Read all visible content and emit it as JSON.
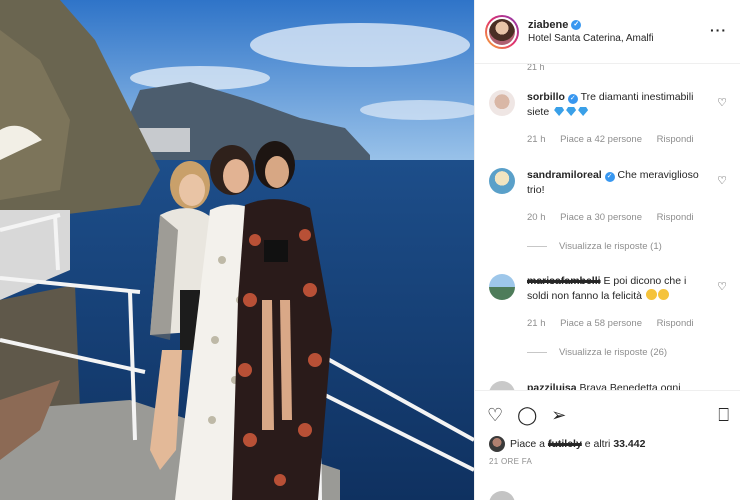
{
  "header": {
    "username": "ziabene",
    "location": "Hotel Santa Caterina, Amalfi",
    "more_icon": "more-horizontal-icon"
  },
  "comments": {
    "truncated_time": "21 h",
    "items": [
      {
        "user": "sorbillo",
        "verified": true,
        "text": "Tre diamanti inestimabili siete",
        "emoji": "gem-icon x3",
        "time": "21 h",
        "likes": "Piace a 42 persone",
        "reply": "Rispondi"
      },
      {
        "user": "sandramiloreal",
        "verified": true,
        "text": "Che meraviglioso trio!",
        "time": "20 h",
        "likes": "Piace a 30 persone",
        "reply": "Rispondi",
        "view_replies": "Visualizza le risposte (1)"
      },
      {
        "user": "marisafambelli",
        "verified": false,
        "text": "E poi dicono che i soldi non fanno la felicità",
        "emoji": "grinning-face x2",
        "time": "21 h",
        "likes": "Piace a 58 persone",
        "reply": "Rispondi",
        "view_replies": "Visualizza le risposte (26)"
      },
      {
        "user": "pazziluisa",
        "verified": false,
        "text": "Brava Benedetta ogni"
      }
    ]
  },
  "actions": {
    "like_icon": "heart-icon",
    "comment_icon": "comment-icon",
    "share_icon": "send-icon",
    "save_icon": "bookmark-icon",
    "likes_prefix": "Piace a",
    "likes_user": "futilely",
    "likes_suffix": "e altri",
    "likes_count": "33.442",
    "time": "21 ORE FA"
  },
  "colors": {
    "verified": "#3897f0",
    "meta_gray": "#8e8e8e",
    "text": "#262626"
  }
}
